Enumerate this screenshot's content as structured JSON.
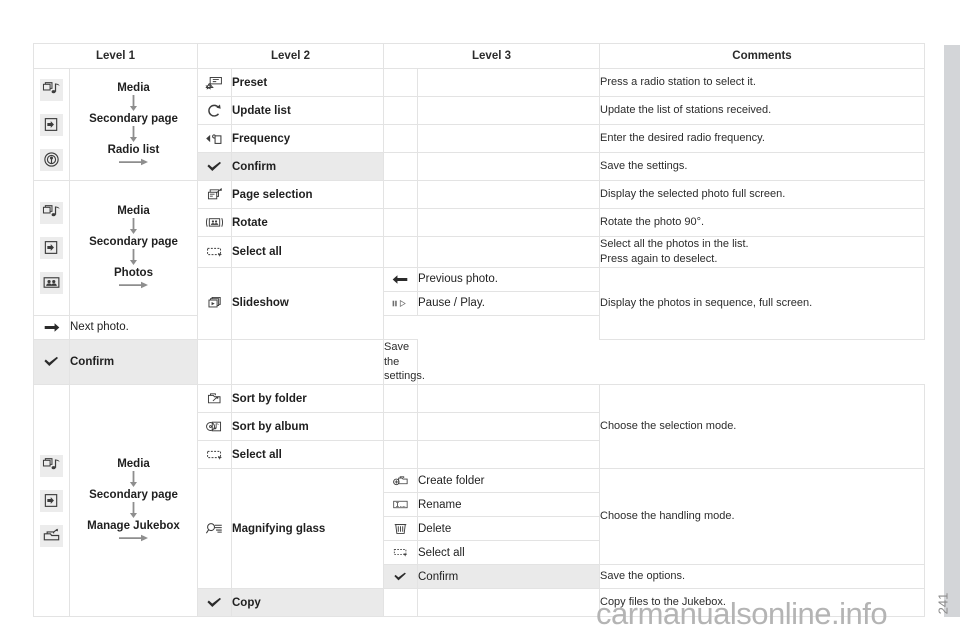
{
  "table": {
    "headers": [
      "Level 1",
      "Level 2",
      "Level 3",
      "Comments"
    ],
    "groups": [
      {
        "id": "radio-list",
        "left_icons": [
          "media-music-icon",
          "source-input-icon",
          "radio-antenna-icon"
        ],
        "path": [
          "Media",
          "Secondary page",
          "Radio list"
        ],
        "rows": [
          {
            "l2_icon": "radio-preset-icon",
            "l2": "Preset",
            "comment": "Press a radio station to select it."
          },
          {
            "l2_icon": "refresh-loop-icon",
            "l2": "Update list",
            "comment": "Update the list of stations received."
          },
          {
            "l2_icon": "tune-hand-icon",
            "l2": "Frequency",
            "comment": "Enter the desired radio frequency."
          },
          {
            "l2_icon": "check-icon",
            "l2": "Confirm",
            "comment": "Save the settings."
          }
        ]
      },
      {
        "id": "photos",
        "left_icons": [
          "media-music-icon",
          "source-input-icon",
          "photo-people-icon"
        ],
        "path": [
          "Media",
          "Secondary page",
          "Photos"
        ],
        "rows": [
          {
            "l2_icon": "page-selection-icon",
            "l2": "Page selection",
            "comment": "Display the selected photo full screen."
          },
          {
            "l2_icon": "rotate-photo-icon",
            "l2": "Rotate",
            "comment": "Rotate the photo 90°."
          },
          {
            "l2_icon": "select-all-icon",
            "l2": "Select all",
            "comment": "Select all the photos in the list.\nPress again to deselect."
          },
          {
            "l2_icon": "slideshow-icon",
            "l2": "Slideshow",
            "comment": "Display the photos in sequence, full screen.",
            "level3": [
              {
                "icon": "arrow-left-icon",
                "label": "Previous photo."
              },
              {
                "icon": "pause-play-icon",
                "label": "Pause / Play."
              },
              {
                "icon": "arrow-right-icon",
                "label": "Next photo."
              }
            ]
          },
          {
            "l2_icon": "check-icon",
            "l2": "Confirm",
            "comment": "Save the settings."
          }
        ]
      },
      {
        "id": "manage-jukebox",
        "left_icons": [
          "media-music-icon",
          "source-input-icon",
          "jukebox-manage-icon"
        ],
        "path": [
          "Media",
          "Secondary page",
          "Manage Jukebox"
        ],
        "rows": [
          {
            "l2_icon": "folder-sort-icon",
            "l2": "Sort by folder",
            "comment": "Choose the selection mode."
          },
          {
            "l2_icon": "album-sort-icon",
            "l2": "Sort by album",
            "comment": ""
          },
          {
            "l2_icon": "select-all-icon",
            "l2": "Select all",
            "comment": ""
          },
          {
            "l2_icon": "magnifier-list-icon",
            "l2": "Magnifying glass",
            "comment": "Choose the handling mode.",
            "level3": [
              {
                "icon": "create-folder-icon",
                "label": "Create folder"
              },
              {
                "icon": "rename-icon",
                "label": "Rename"
              },
              {
                "icon": "trash-icon",
                "label": "Delete"
              },
              {
                "icon": "select-all-icon",
                "label": "Select all"
              },
              {
                "icon": "check-icon",
                "label": "Confirm",
                "comment": "Save the options."
              }
            ]
          },
          {
            "l2_icon": "check-icon",
            "l2": "Copy",
            "comment": "Copy files to the Jukebox."
          }
        ]
      }
    ]
  },
  "footer": {
    "watermark": "carmanualsonline.info",
    "page_number": "241"
  },
  "colors": {
    "header_bg": "#e9e9e9",
    "comment_bg": "#e9e9e9",
    "shade_bg": "#eaeaea",
    "border": "#e3e3e3",
    "side_bar": "#d3d5d8",
    "text": "#1f1f1f"
  }
}
